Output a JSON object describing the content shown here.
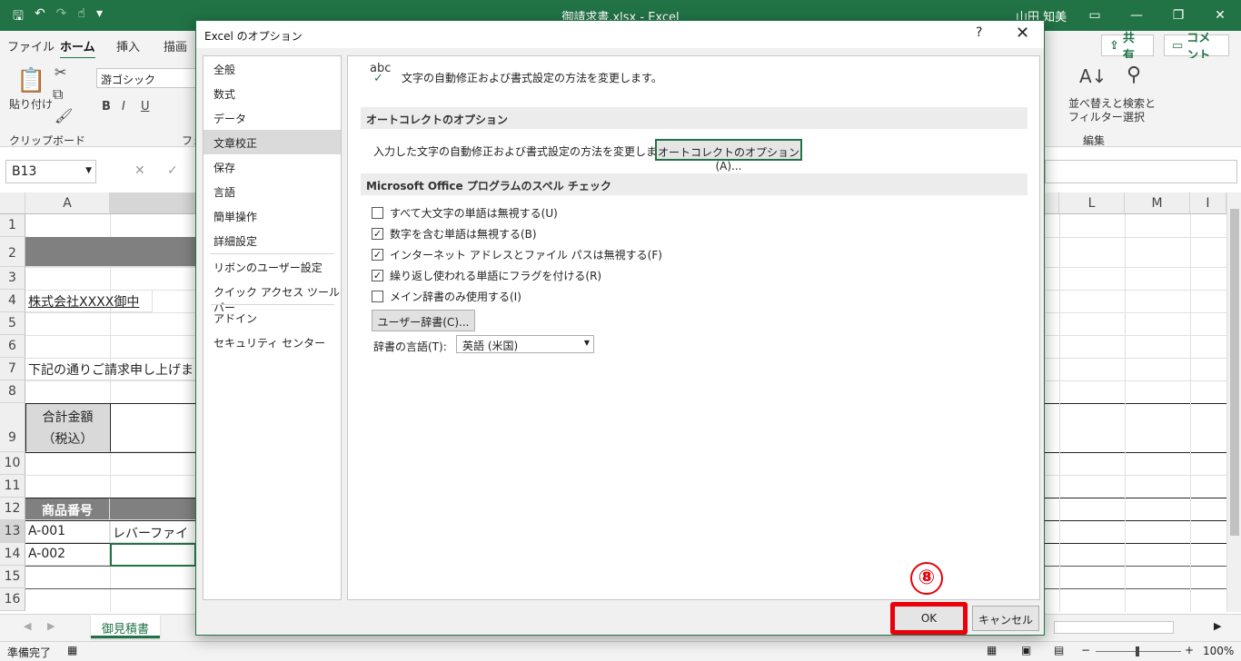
{
  "excel": {
    "doc_title": "御請求書.xlsx  -  Excel",
    "user": "山田 知美",
    "tabs": [
      "ファイル",
      "ホーム",
      "挿入",
      "描画"
    ],
    "share": "共有",
    "comment": "コメント",
    "font_name": "游ゴシック",
    "paste_label": "貼り付け",
    "clipboard_group": "クリップボード",
    "font_group_partial": "フォ",
    "edit_group": "編集",
    "sort_filter": [
      "並べ替えと",
      "フィルター"
    ],
    "find_select": [
      "検索と",
      "選択"
    ],
    "name_box": "B13",
    "col_headers": [
      "A",
      "L",
      "M",
      "I"
    ],
    "row_headers": [
      "1",
      "2",
      "3",
      "4",
      "5",
      "6",
      "7",
      "8",
      "9",
      "10",
      "11",
      "12",
      "13",
      "14",
      "15",
      "16"
    ],
    "cells": {
      "a4": "株式会社XXXX御中",
      "a7": "下記の通りご請求申し上げま",
      "a9_line1": "合計金額",
      "a9_line2": "（税込）",
      "a11": "商品番号",
      "a12": "A-001",
      "b12": "レバーファイ",
      "a13": "A-002"
    },
    "sheet_tab": "御見積書",
    "status": "準備完了",
    "zoom": "100%"
  },
  "dialog": {
    "title": "Excel のオプション",
    "help": "?",
    "nav": {
      "group1": [
        "全般",
        "数式",
        "データ",
        "文章校正",
        "保存",
        "言語",
        "簡単操作",
        "詳細設定"
      ],
      "group2": [
        "リボンのユーザー設定",
        "クイック アクセス ツール バー"
      ],
      "group3": [
        "アドイン",
        "セキュリティ センター"
      ]
    },
    "header_icon_text": "abc",
    "header_text": "文字の自動修正および書式設定の方法を変更します。",
    "autocorrect_section": "オートコレクトのオプション",
    "autocorrect_desc": "入力した文字の自動修正および書式設定の方法を変更します:",
    "autocorrect_button": "オートコレクトのオプション(A)...",
    "spell_section": "Microsoft Office プログラムのスペル チェック",
    "checkboxes": [
      {
        "label": "すべて大文字の単語は無視する(U)",
        "checked": false
      },
      {
        "label": "数字を含む単語は無視する(B)",
        "checked": true
      },
      {
        "label": "インターネット アドレスとファイル パスは無視する(F)",
        "checked": true
      },
      {
        "label": "繰り返し使われる単語にフラグを付ける(R)",
        "checked": true
      },
      {
        "label": "メイン辞書のみ使用する(I)",
        "checked": false
      }
    ],
    "user_dict_button": "ユーザー辞書(C)...",
    "dict_lang_label": "辞書の言語(T):",
    "dict_lang_value": "英語 (米国)",
    "ok": "OK",
    "cancel": "キャンセル",
    "step_badge": "⑧"
  },
  "colors": {
    "excel_green": "#217346",
    "highlight_red": "#e8000b",
    "header_gray": "#808080"
  }
}
